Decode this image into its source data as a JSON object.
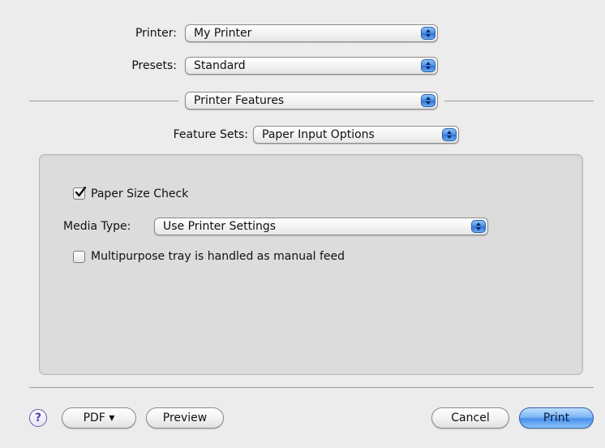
{
  "printer": {
    "label": "Printer:",
    "value": "My Printer"
  },
  "presets": {
    "label": "Presets:",
    "value": "Standard"
  },
  "panel_selector": {
    "value": "Printer Features"
  },
  "feature_sets": {
    "label": "Feature Sets:",
    "value": "Paper Input Options"
  },
  "options": {
    "paper_size_check": {
      "label": "Paper Size Check",
      "checked": true
    },
    "media_type": {
      "label": "Media Type:",
      "value": "Use Printer Settings"
    },
    "manual_feed": {
      "label": "Multipurpose tray is handled as manual feed",
      "checked": false
    }
  },
  "footer": {
    "help_symbol": "?",
    "pdf_label": "PDF ▾",
    "preview_label": "Preview",
    "cancel_label": "Cancel",
    "print_label": "Print"
  },
  "colors": {
    "accent": "#4a90ea",
    "background": "#ececec",
    "groupbox": "#dcdcdc"
  }
}
